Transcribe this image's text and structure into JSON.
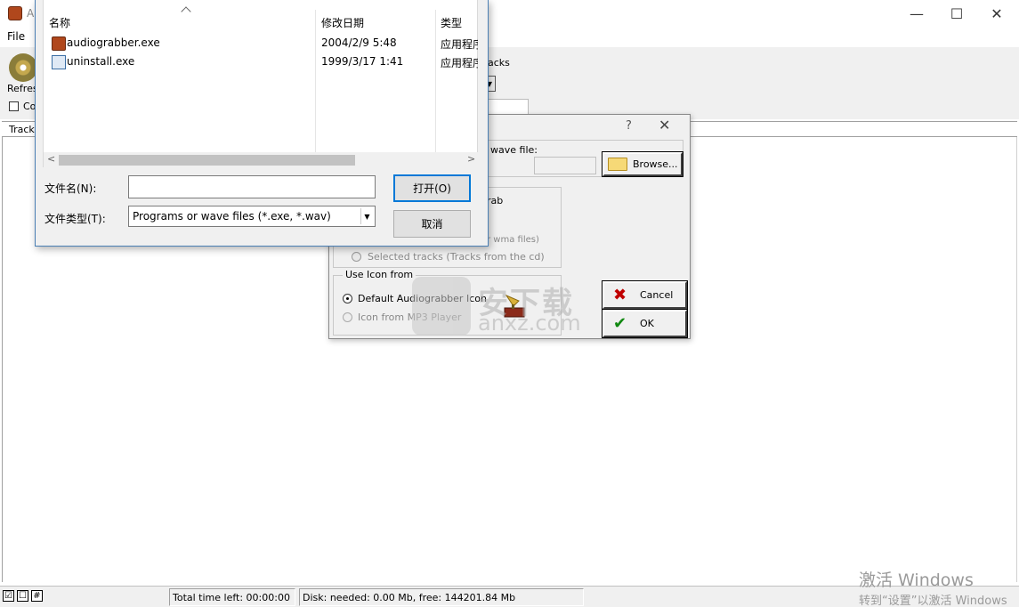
{
  "main": {
    "title": "A",
    "menu": [
      "File"
    ],
    "toolbar": {
      "refresh_label": "Refresh",
      "tracks_label": "acks"
    },
    "option_label": "Co",
    "list": {
      "column_track": "Track"
    },
    "status": {
      "checks": [
        "☑",
        "☐",
        "#"
      ],
      "total_time": "Total time left: 00:00:00",
      "disk": "Disk: needed: 0.00 Mb, free: 144201.84 Mb"
    },
    "window_buttons": {
      "minimize": "—",
      "maximize": "☐",
      "close": "✕"
    }
  },
  "watermark": {
    "line1": "激活 Windows",
    "line2": "转到“设置”以激活 Windows"
  },
  "logo_watermark": {
    "cn": "安下载",
    "en": "anxz.com"
  },
  "settings_dialog": {
    "help": "?",
    "close": "✕",
    "wave_label": "wave file:",
    "browse_label": "Browse...",
    "grab_label": "rab",
    "wma_label": "r wma files)",
    "selected_tracks": "Selected tracks  (Tracks from the cd)",
    "icon_group_legend": "Use Icon from",
    "default_icon": "Default  Audiograbber Icon",
    "mp3_icon": "Icon from MP3 Player",
    "cancel_label": "Cancel",
    "ok_label": "OK",
    "cancel_glyph": "✖",
    "ok_glyph": "✔"
  },
  "open_dialog": {
    "columns": {
      "name": "名称",
      "date": "修改日期",
      "type": "类型"
    },
    "files": [
      {
        "name": "audiograbber.exe",
        "date": "2004/2/9 5:48",
        "type": "应用程序"
      },
      {
        "name": "uninstall.exe",
        "date": "1999/3/17 1:41",
        "type": "应用程序"
      }
    ],
    "scroll": {
      "left": "<",
      "right": ">"
    },
    "filename_label": "文件名(N):",
    "filename_value": "",
    "filetype_label": "文件类型(T):",
    "filetype_value": "Programs or wave files (*.exe, *.wav)",
    "open_button": "打开(O)",
    "cancel_button": "取消"
  }
}
